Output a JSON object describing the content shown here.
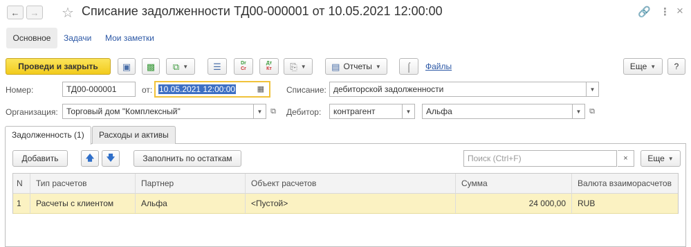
{
  "window": {
    "title": "Списание задолженности ТД00-000001 от 10.05.2021 12:00:00"
  },
  "icons": {
    "back": "arrow-left-icon",
    "forward": "arrow-right-icon",
    "favorite": "star-icon",
    "link": "link-icon",
    "more": "more-vertical-icon",
    "close": "close-icon"
  },
  "nav": {
    "main": "Основное",
    "tasks": "Задачи",
    "notes": "Мои заметки"
  },
  "toolbar": {
    "post_close": "Проведи и закрыть",
    "reports": "Отчеты",
    "files": "Файлы",
    "more": "Еще",
    "help": "?",
    "dt_kt_top": "Dr",
    "dt_kt_bottom": "Cr",
    "dt_top": "Дт",
    "dt_bottom": "Кт"
  },
  "form": {
    "number_label": "Номер:",
    "number": "ТД00-000001",
    "date_label": "от:",
    "date": "10.05.2021 12:00:00",
    "writeoff_label": "Списание:",
    "writeoff": "дебиторской задолженности",
    "org_label": "Организация:",
    "org": "Торговый дом \"Комплексный\"",
    "debtor_label": "Дебитор:",
    "debtor_type": "контрагент",
    "debtor": "Альфа"
  },
  "tabs": {
    "debt": "Задолженность (1)",
    "expenses": "Расходы и активы"
  },
  "table_toolbar": {
    "add": "Добавить",
    "fill": "Заполнить по остаткам",
    "search_placeholder": "Поиск (Ctrl+F)",
    "more": "Еще"
  },
  "table": {
    "columns": [
      "N",
      "Тип расчетов",
      "Партнер",
      "Объект расчетов",
      "Сумма",
      "Валюта взаиморасчетов"
    ],
    "rows": [
      [
        "1",
        "Расчеты с клиентом",
        "Альфа",
        "<Пустой>",
        "24 000,00",
        "RUB"
      ]
    ]
  },
  "colors": {
    "primary_button": "#f2cb1c",
    "selected_row": "#fbf2c2",
    "link": "#2b57a5",
    "focus_border": "#f0c23a"
  }
}
